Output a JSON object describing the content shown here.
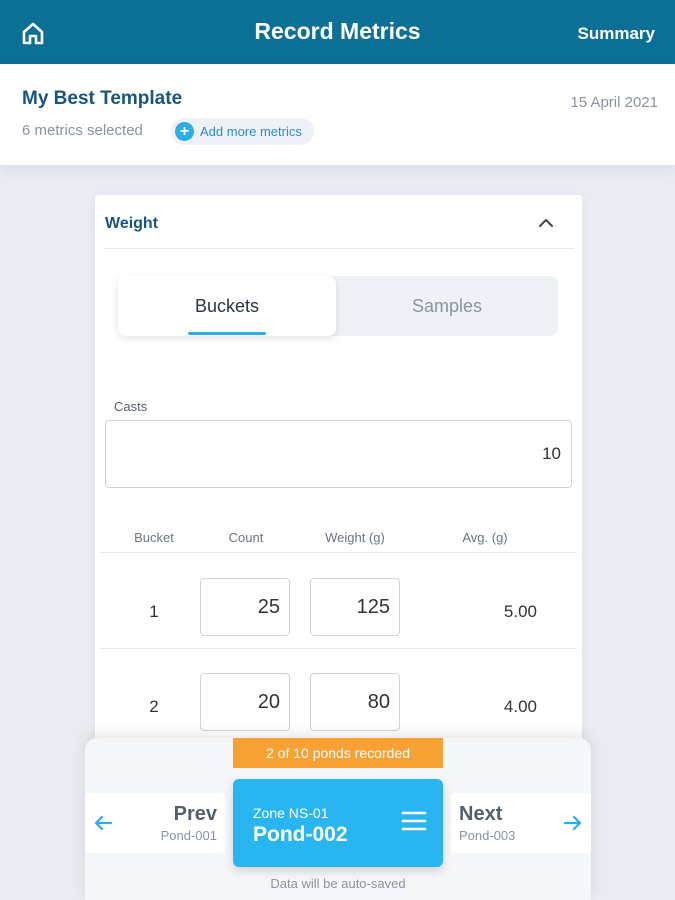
{
  "header": {
    "title": "Record Metrics",
    "summary_label": "Summary",
    "home_icon": "home-icon"
  },
  "template": {
    "name": "My Best Template",
    "date": "15 April 2021",
    "metrics_selected": "6 metrics selected",
    "add_more_label": "Add more metrics"
  },
  "weight_card": {
    "title": "Weight",
    "tabs": [
      {
        "label": "Buckets",
        "active": true
      },
      {
        "label": "Samples",
        "active": false
      }
    ],
    "casts_label": "Casts",
    "casts_value": "10",
    "columns": [
      "Bucket",
      "Count",
      "Weight (g)",
      "Avg. (g)"
    ],
    "rows": [
      {
        "bucket": "1",
        "count": "25",
        "weight": "125",
        "avg": "5.00"
      },
      {
        "bucket": "2",
        "count": "20",
        "weight": "80",
        "avg": "4.00"
      }
    ]
  },
  "pond_nav": {
    "progress": "2 of 10 ponds recorded",
    "prev": {
      "label": "Prev",
      "pond": "Pond-001"
    },
    "current": {
      "zone": "Zone NS-01",
      "pond": "Pond-002"
    },
    "next": {
      "label": "Next",
      "pond": "Pond-003"
    },
    "autosave_note": "Data will be auto-saved"
  },
  "colors": {
    "header_bg": "#0c6f95",
    "accent": "#29aee6",
    "current_pond_bg": "#29b6f0",
    "progress_badge": "#f7a133"
  }
}
